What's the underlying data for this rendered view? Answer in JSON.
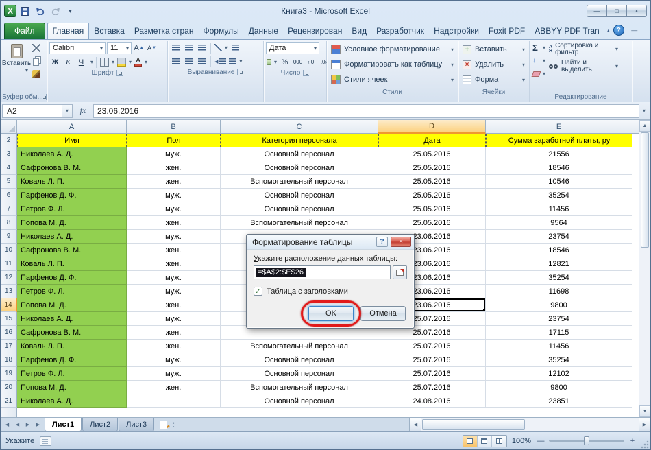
{
  "window": {
    "title": "Книга3  -  Microsoft Excel",
    "app_icon_letter": "X"
  },
  "icons": {
    "caret_down": "▾",
    "chevron_up": "▴",
    "arrow_up": "▲",
    "arrow_down": "▼",
    "arrow_left": "◀",
    "arrow_right": "▶",
    "close": "×",
    "minimize": "—",
    "maximize": "□",
    "help": "?",
    "check": "✓",
    "insert_star": "*",
    "splitter": "⁞"
  },
  "ribbon": {
    "file_tab": "Файл",
    "active_tab": "Главная",
    "tabs": [
      "Главная",
      "Вставка",
      "Разметка стран",
      "Формулы",
      "Данные",
      "Рецензирован",
      "Вид",
      "Разработчик",
      "Надстройки",
      "Foxit PDF",
      "ABBYY PDF Tran"
    ],
    "groups": {
      "clipboard": {
        "label": "Буфер обм...",
        "paste": "Вставить"
      },
      "font": {
        "label": "Шрифт",
        "font_name": "Calibri",
        "font_size": "11",
        "bold": "Ж",
        "italic": "К",
        "underline": "Ч",
        "grow": "А",
        "shrink": "А"
      },
      "alignment": {
        "label": "Выравнивание"
      },
      "number": {
        "label": "Число",
        "format": "Дата",
        "percent": "%",
        "thousands": "000",
        "inc_decimal": "‹.0",
        "dec_decimal": ".0›"
      },
      "styles": {
        "label": "Стили",
        "conditional": "Условное форматирование",
        "format_table": "Форматировать как таблицу",
        "cell_styles": "Стили ячеек"
      },
      "cells": {
        "label": "Ячейки",
        "insert": "Вставить",
        "delete": "Удалить",
        "format": "Формат",
        "insert_glyph": "+",
        "delete_glyph": "×"
      },
      "editing": {
        "label": "Редактирование",
        "autosum": "Σ",
        "fill_glyph": "↓",
        "sort": "Сортировка и фильтр",
        "find": "Найти и выделить",
        "sort_a": "А",
        "sort_z": "Я"
      }
    }
  },
  "formula_bar": {
    "name_box": "A2",
    "fx": "fx",
    "formula": "23.06.2016"
  },
  "sheet": {
    "columns": [
      "A",
      "B",
      "C",
      "D",
      "E"
    ],
    "selected_column": "D",
    "active_row": 14,
    "active_cell": {
      "row": 14,
      "col": 3
    },
    "rows": [
      {
        "num": 2,
        "header": true,
        "cells": [
          "Имя",
          "Пол",
          "Категория персонала",
          "Дата",
          "Сумма заработной платы, ру"
        ]
      },
      {
        "num": 3,
        "cells": [
          "Николаев А. Д.",
          "муж.",
          "Основной персонал",
          "25.05.2016",
          "21556"
        ]
      },
      {
        "num": 4,
        "cells": [
          "Сафронова В. М.",
          "жен.",
          "Основной персонал",
          "25.05.2016",
          "18546"
        ]
      },
      {
        "num": 5,
        "cells": [
          "Коваль Л. П.",
          "жен.",
          "Вспомогательный персонал",
          "25.05.2016",
          "10546"
        ]
      },
      {
        "num": 6,
        "cells": [
          "Парфенов Д. Ф.",
          "муж.",
          "Основной персонал",
          "25.05.2016",
          "35254"
        ]
      },
      {
        "num": 7,
        "cells": [
          "Петров Ф. Л.",
          "муж.",
          "Основной персонал",
          "25.05.2016",
          "11456"
        ]
      },
      {
        "num": 8,
        "cells": [
          "Попова М. Д.",
          "жен.",
          "Вспомогательный персонал",
          "25.05.2016",
          "9564"
        ]
      },
      {
        "num": 9,
        "cells": [
          "Николаев А. Д.",
          "муж.",
          "",
          "23.06.2016",
          "23754"
        ]
      },
      {
        "num": 10,
        "cells": [
          "Сафронова В. М.",
          "жен.",
          "",
          "23.06.2016",
          "18546"
        ]
      },
      {
        "num": 11,
        "cells": [
          "Коваль Л. П.",
          "жен.",
          "",
          "23.06.2016",
          "12821"
        ]
      },
      {
        "num": 12,
        "cells": [
          "Парфенов Д. Ф.",
          "муж.",
          "",
          "23.06.2016",
          "35254"
        ]
      },
      {
        "num": 13,
        "cells": [
          "Петров Ф. Л.",
          "муж.",
          "",
          "23.06.2016",
          "11698"
        ]
      },
      {
        "num": 14,
        "cells": [
          "Попова М. Д.",
          "жен.",
          "",
          "23.06.2016",
          "9800"
        ]
      },
      {
        "num": 15,
        "cells": [
          "Николаев А. Д.",
          "муж.",
          "",
          "25.07.2016",
          "23754"
        ]
      },
      {
        "num": 16,
        "cells": [
          "Сафронова В. М.",
          "жен.",
          "",
          "25.07.2016",
          "17115"
        ]
      },
      {
        "num": 17,
        "cells": [
          "Коваль Л. П.",
          "жен.",
          "Вспомогательный персонал",
          "25.07.2016",
          "11456"
        ]
      },
      {
        "num": 18,
        "cells": [
          "Парфенов Д. Ф.",
          "муж.",
          "Основной персонал",
          "25.07.2016",
          "35254"
        ]
      },
      {
        "num": 19,
        "cells": [
          "Петров Ф. Л.",
          "муж.",
          "Основной персонал",
          "25.07.2016",
          "12102"
        ]
      },
      {
        "num": 20,
        "cells": [
          "Попова М. Д.",
          "жен.",
          "Вспомогательный персонал",
          "25.07.2016",
          "9800"
        ]
      },
      {
        "num": 21,
        "cells": [
          "Николаев А. Д.",
          "",
          "Основной персонал",
          "24.08.2016",
          "23851"
        ]
      }
    ]
  },
  "dialog": {
    "title": "Форматирование таблицы",
    "label": "Укажите расположение данных таблицы:",
    "range": "=$A$2:$E$26",
    "checkbox": "Таблица с заголовками",
    "checkbox_checked": true,
    "ok": "OK",
    "cancel": "Отмена"
  },
  "sheet_tabs": {
    "tabs": [
      "Лист1",
      "Лист2",
      "Лист3"
    ],
    "active": "Лист1"
  },
  "status": {
    "mode": "Укажите",
    "zoom": "100%"
  }
}
